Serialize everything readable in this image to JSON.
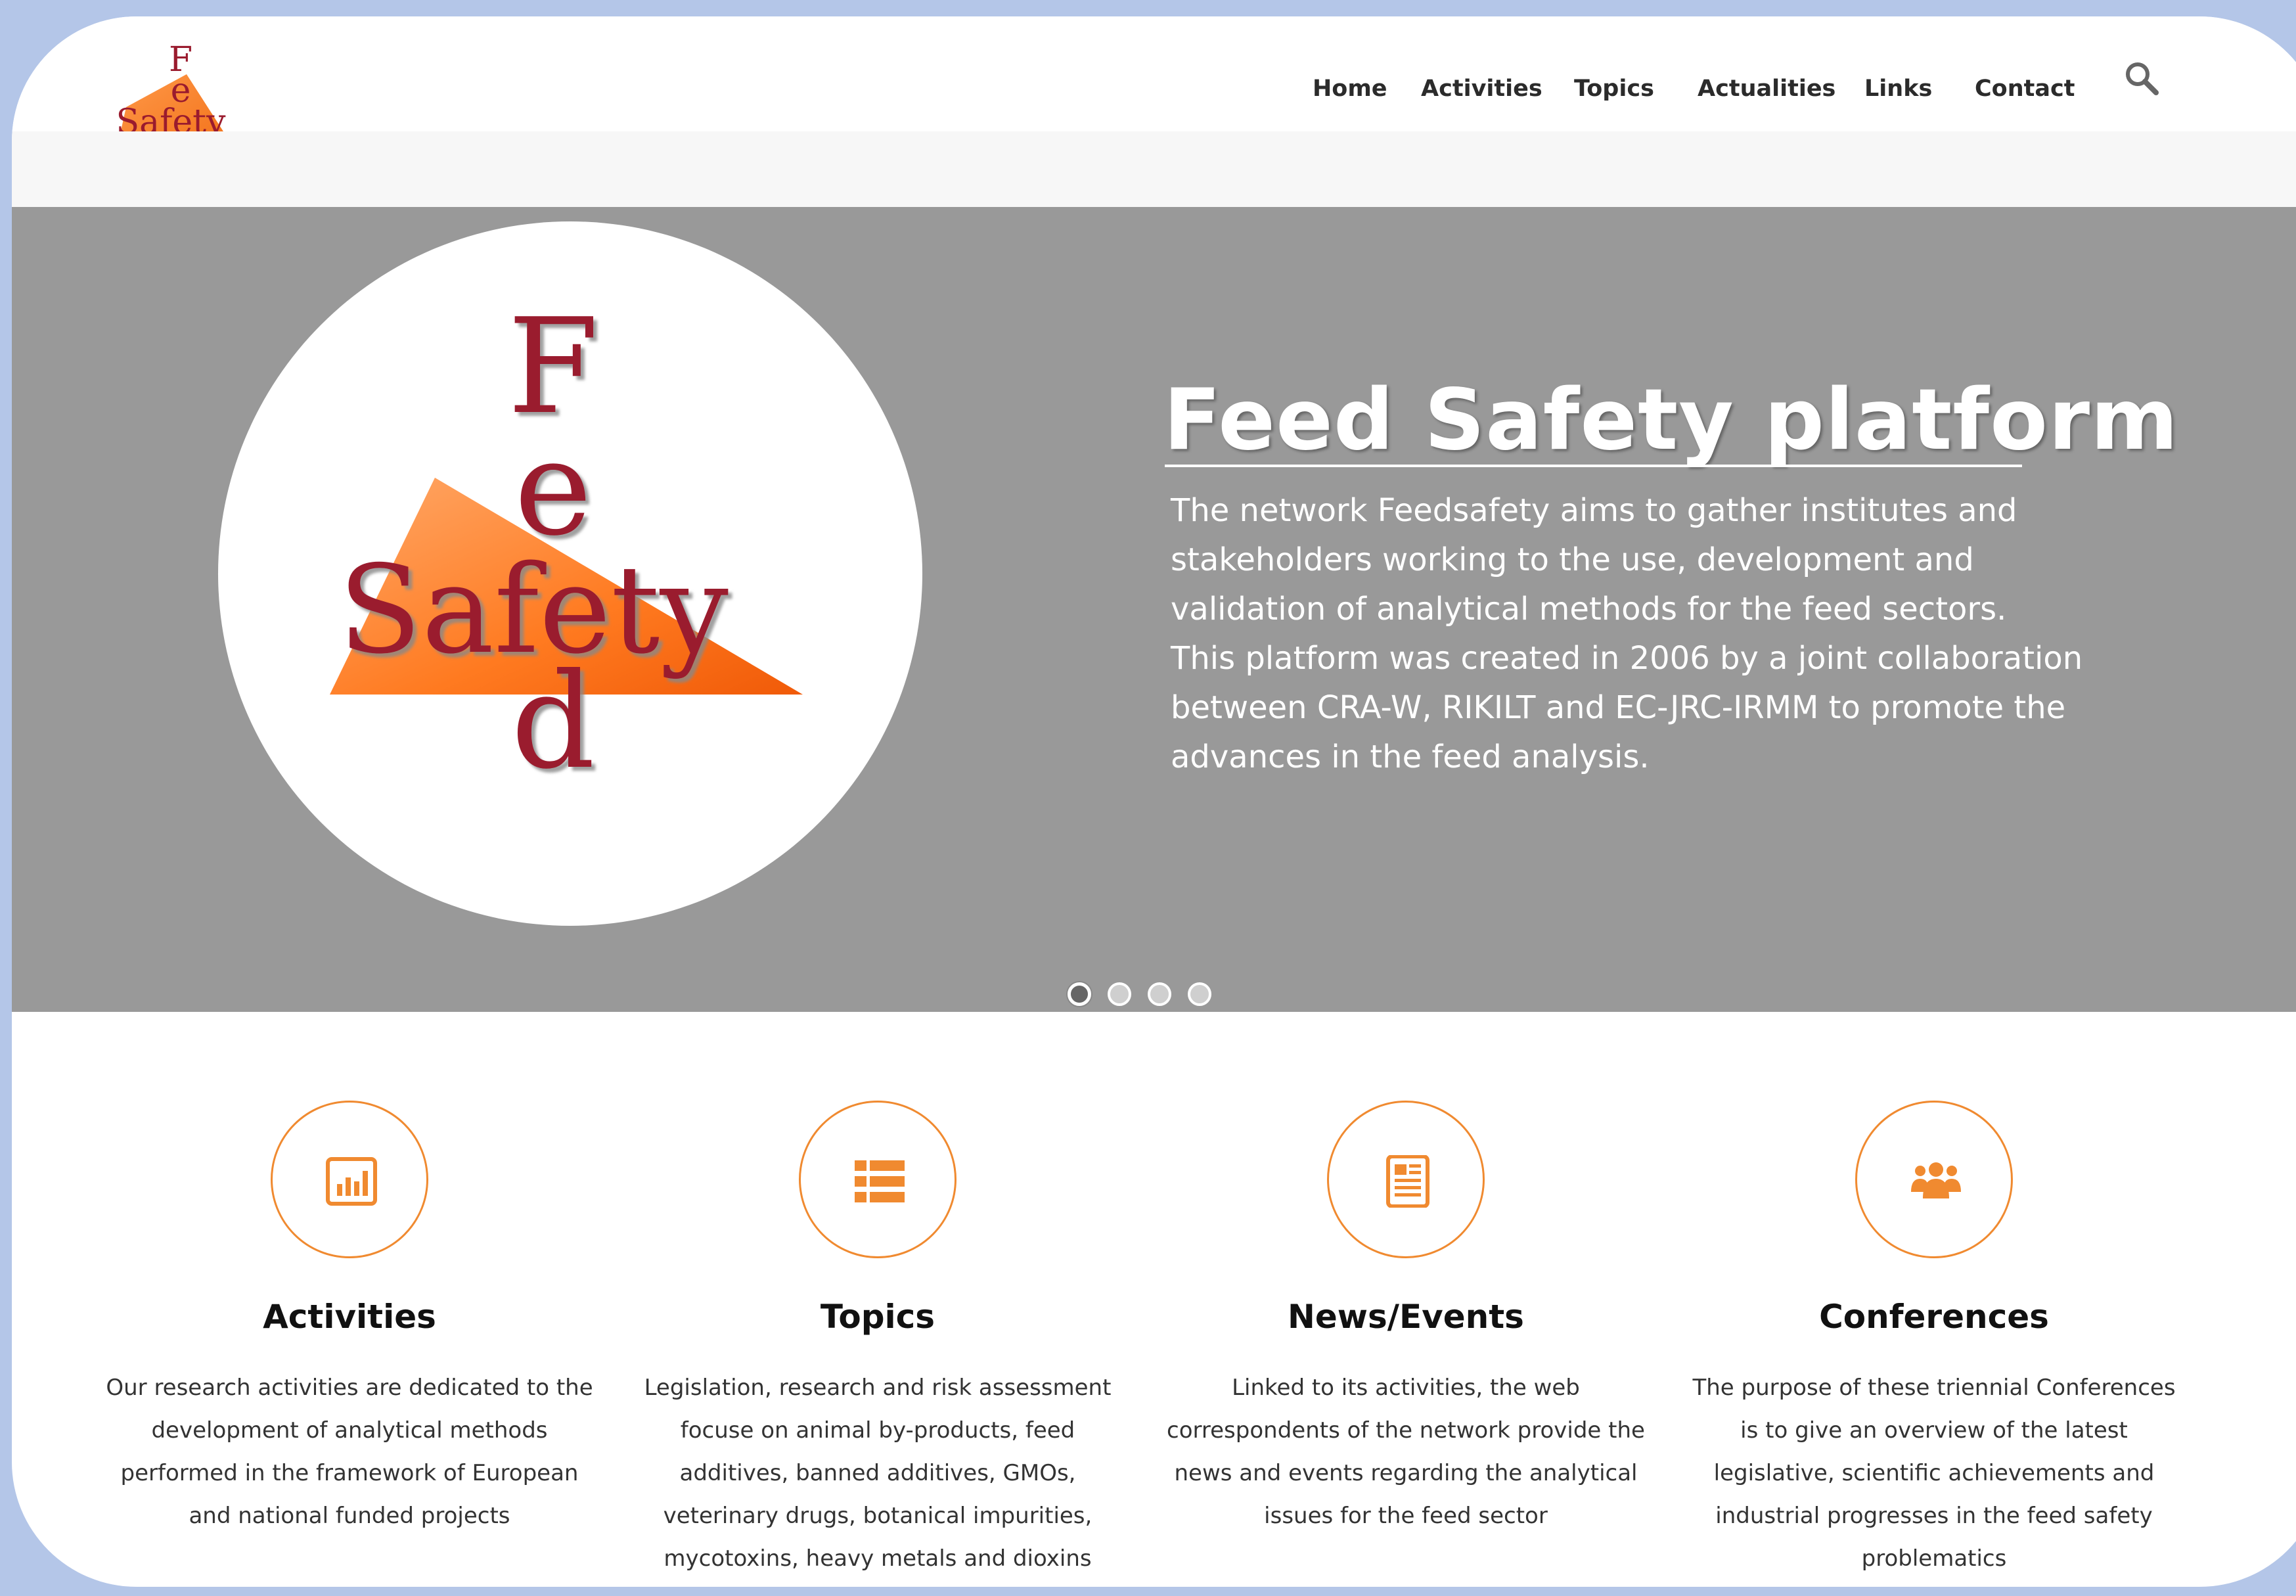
{
  "brand": {
    "logo_letters": [
      "F",
      "e",
      "Safety",
      "d"
    ]
  },
  "nav": {
    "items": [
      "Home",
      "Activities",
      "Topics",
      "Actualities",
      "Links",
      "Contact"
    ]
  },
  "hero": {
    "title": "Feed Safety platform",
    "lines": [
      "The network Feedsafety aims to gather institutes and",
      "stakeholders working to the use, development and",
      "validation of analytical methods for the feed sectors.",
      "This platform was created in 2006 by a joint collaboration",
      "between CRA-W, RIKILT and EC-JRC-IRMM to promote the",
      "advances in the feed analysis."
    ],
    "slides_total": 4,
    "active_slide": 1
  },
  "features": [
    {
      "icon": "bar-chart-icon",
      "title": "Activities",
      "lines": [
        "Our research activities are dedicated to the",
        "development of analytical methods",
        "performed in the framework of European",
        "and national funded projects"
      ]
    },
    {
      "icon": "list-icon",
      "title": "Topics",
      "lines": [
        "Legislation, research and risk assessment",
        "focuse on animal by-products, feed",
        "additives, banned additives, GMOs,",
        "veterinary drugs,  botanical impurities,",
        "mycotoxins, heavy metals and dioxins"
      ]
    },
    {
      "icon": "newspaper-icon",
      "title": "News/Events",
      "lines": [
        "Linked to its activities, the web",
        "correspondents of the network provide the",
        "news and events regarding the analytical",
        "issues for the feed sector"
      ]
    },
    {
      "icon": "users-icon",
      "title": "Conferences",
      "lines": [
        "The purpose of these triennial Conferences",
        "is to give an overview of the latest",
        "legislative, scientific achievements and",
        "industrial progresses in the feed safety",
        "problematics"
      ]
    }
  ],
  "colors": {
    "page_background": "#b4c6e8",
    "hero_background": "#999999",
    "accent_orange": "#f08a30",
    "logo_red": "#9a1b2e"
  }
}
